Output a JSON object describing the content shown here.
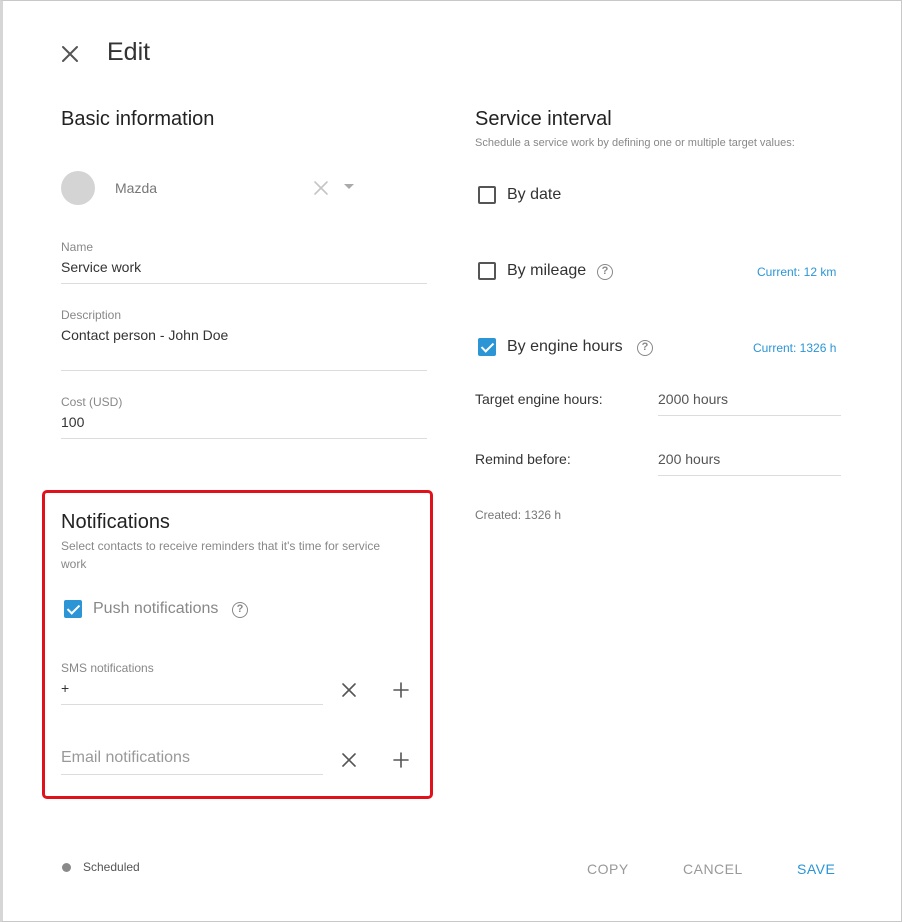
{
  "header": {
    "title": "Edit",
    "close_icon": "close-icon"
  },
  "basic": {
    "title": "Basic information",
    "vehicle": {
      "name": "Mazda"
    },
    "name": {
      "label": "Name",
      "value": "Service work"
    },
    "description": {
      "label": "Description",
      "value": "Contact person - John Doe"
    },
    "cost": {
      "label": "Cost (USD)",
      "value": "100"
    }
  },
  "notifications": {
    "title": "Notifications",
    "subtitle_line1": "Select contacts to receive reminders that it's time for service",
    "subtitle_line2": "work",
    "push": {
      "label": "Push notifications",
      "checked": true
    },
    "sms": {
      "label": "SMS notifications",
      "value": "+"
    },
    "email": {
      "placeholder": "Email notifications"
    }
  },
  "interval": {
    "title": "Service interval",
    "subtitle": "Schedule a service work by defining one or multiple target values:",
    "by_date": {
      "label": "By date",
      "checked": false
    },
    "by_mileage": {
      "label": "By mileage",
      "checked": false,
      "current": "Current: 12 km"
    },
    "by_engine_hours": {
      "label": "By engine hours",
      "checked": true,
      "current": "Current: 1326 h"
    },
    "target_engine_hours": {
      "label": "Target engine hours:",
      "value": "2000 hours"
    },
    "remind_before": {
      "label": "Remind before:",
      "value": "200 hours"
    },
    "created": "Created: 1326 h"
  },
  "footer": {
    "status": "Scheduled",
    "copy": "COPY",
    "cancel": "CANCEL",
    "save": "SAVE"
  },
  "colors": {
    "accent": "#2b95d6",
    "highlight": "#e0111b",
    "status_dot": "#8a8a8a"
  }
}
